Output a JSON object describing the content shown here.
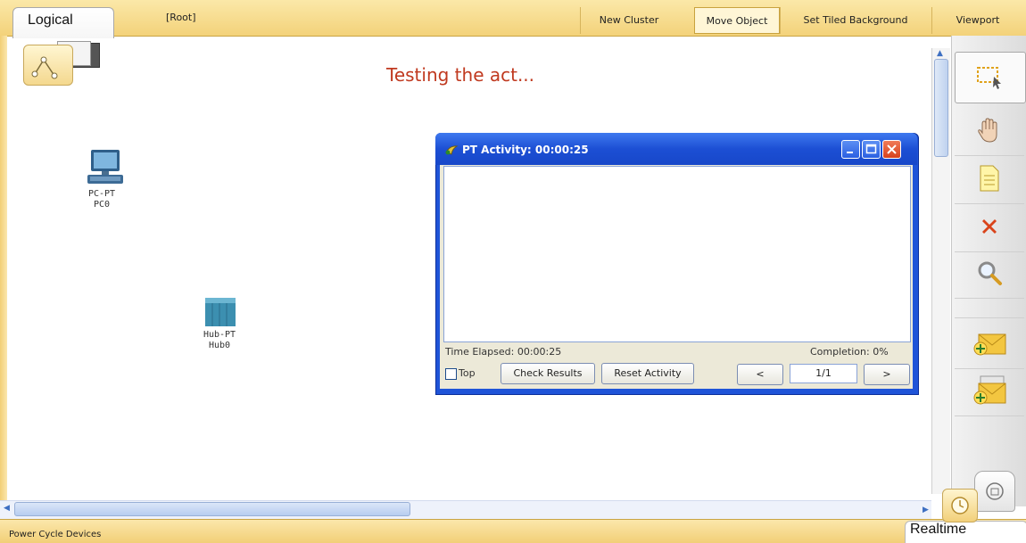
{
  "topbar": {
    "tab_label": "Logical",
    "root_label": "[Root]",
    "buttons": [
      "New Cluster",
      "Move Object",
      "Set Tiled Background",
      "Viewport"
    ]
  },
  "canvas": {
    "title": "Testing the act..."
  },
  "devices": [
    {
      "type": "PC-PT",
      "name": "PC0"
    },
    {
      "type": "Hub-PT",
      "name": "Hub0"
    }
  ],
  "activity_window": {
    "title": "PT Activity: 00:00:25",
    "time_elapsed": "Time Elapsed: 00:00:25",
    "completion": "Completion: 0%",
    "top_label": "Top",
    "check_results": "Check Results",
    "reset_activity": "Reset Activity",
    "prev": "<",
    "next": ">",
    "page": "1/1"
  },
  "status": {
    "left_text": "Power Cycle Devices",
    "mode_tab": "Realtime"
  },
  "icons": {
    "tools": [
      "select-icon",
      "hand-icon",
      "note-icon",
      "delete-icon",
      "zoom-icon",
      "add-simple-pdu-icon",
      "add-complex-pdu-icon"
    ],
    "colors": {
      "title_red": "#c0391f",
      "toolbar_yellow": "#f3d27a",
      "xp_blue": "#1f54d8"
    }
  }
}
